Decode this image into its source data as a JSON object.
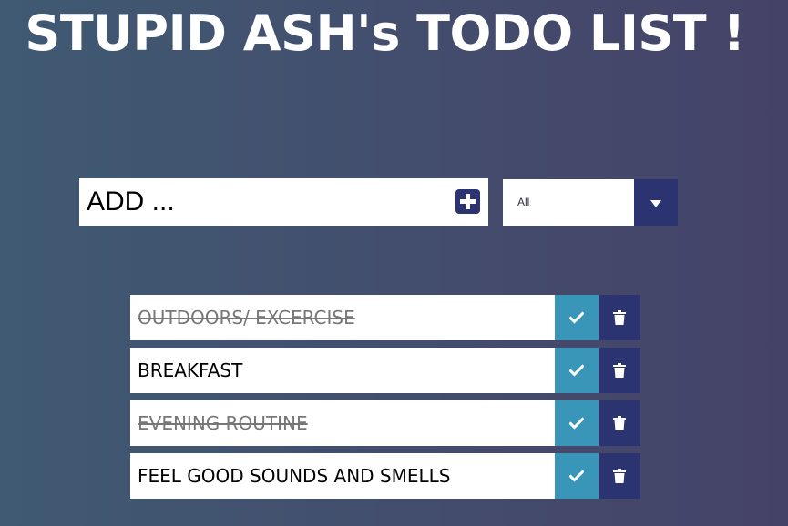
{
  "header": {
    "title": "STUPID ASH's TODO LIST !"
  },
  "add_form": {
    "placeholder": "ADD ...",
    "add_icon": "plus-square-icon"
  },
  "filter": {
    "selected": "All",
    "icon": "caret-down-icon"
  },
  "todos": [
    {
      "text": "OUTDOORS/ EXCERCISE",
      "completed": true
    },
    {
      "text": "BREAKFAST",
      "completed": false
    },
    {
      "text": "EVENING ROUTINE",
      "completed": true
    },
    {
      "text": "FEEL GOOD SOUNDS AND SMELLS",
      "completed": false
    }
  ],
  "colors": {
    "background_left": "#3f5a72",
    "background_right": "#454268",
    "complete_button": "#3996b8",
    "trash_button": "#2b3370",
    "accent": "#2b3370"
  },
  "icons": {
    "complete": "check-icon",
    "delete": "trash-icon"
  }
}
